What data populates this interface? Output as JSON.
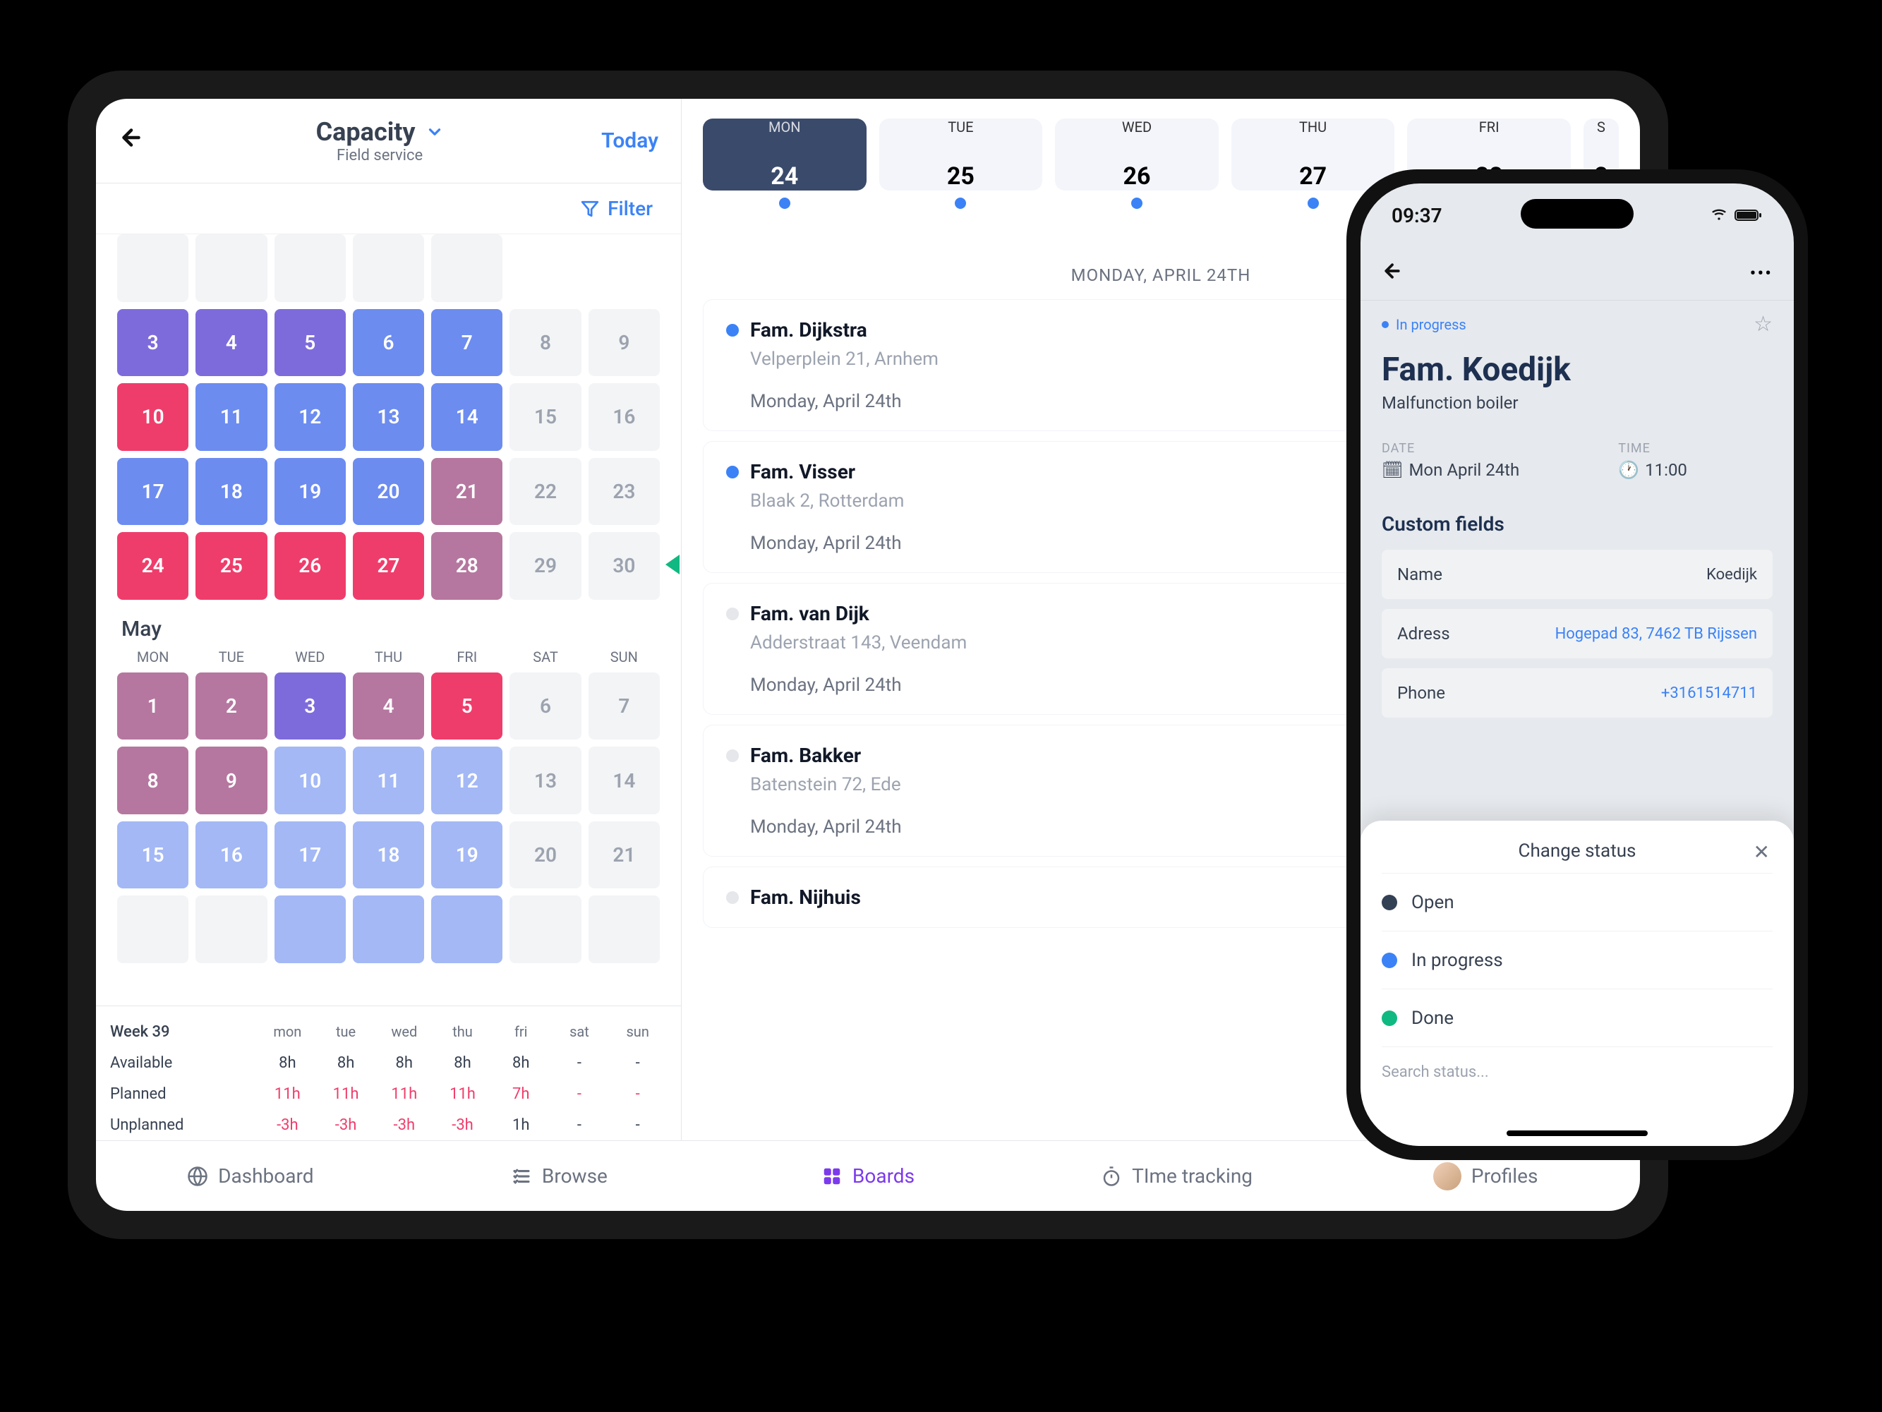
{
  "tablet": {
    "header": {
      "title": "Capacity",
      "subtitle": "Field service",
      "today": "Today",
      "filter": "Filter"
    },
    "calendar_top": {
      "rows": [
        [
          {
            "n": "3",
            "c": "purple"
          },
          {
            "n": "4",
            "c": "purple"
          },
          {
            "n": "5",
            "c": "purple"
          },
          {
            "n": "6",
            "c": "blue"
          },
          {
            "n": "7",
            "c": "blue"
          },
          {
            "n": "8",
            "c": "dim"
          },
          {
            "n": "9",
            "c": "dim"
          }
        ],
        [
          {
            "n": "10",
            "c": "pink"
          },
          {
            "n": "11",
            "c": "blue"
          },
          {
            "n": "12",
            "c": "blue"
          },
          {
            "n": "13",
            "c": "blue"
          },
          {
            "n": "14",
            "c": "blue"
          },
          {
            "n": "15",
            "c": "dim"
          },
          {
            "n": "16",
            "c": "dim"
          }
        ],
        [
          {
            "n": "17",
            "c": "blue"
          },
          {
            "n": "18",
            "c": "blue"
          },
          {
            "n": "19",
            "c": "blue"
          },
          {
            "n": "20",
            "c": "blue"
          },
          {
            "n": "21",
            "c": "mauve"
          },
          {
            "n": "22",
            "c": "dim"
          },
          {
            "n": "23",
            "c": "dim"
          }
        ],
        [
          {
            "n": "24",
            "c": "pink"
          },
          {
            "n": "25",
            "c": "pink"
          },
          {
            "n": "26",
            "c": "pink"
          },
          {
            "n": "27",
            "c": "pink"
          },
          {
            "n": "28",
            "c": "mauve"
          },
          {
            "n": "29",
            "c": "dim"
          },
          {
            "n": "30",
            "c": "dim"
          }
        ]
      ]
    },
    "month2_label": "May",
    "dow_full": [
      "MON",
      "TUE",
      "WED",
      "THU",
      "FRI",
      "SAT",
      "SUN"
    ],
    "calendar_may": {
      "rows": [
        [
          {
            "n": "1",
            "c": "mauve"
          },
          {
            "n": "2",
            "c": "mauve"
          },
          {
            "n": "3",
            "c": "purple"
          },
          {
            "n": "4",
            "c": "mauve"
          },
          {
            "n": "5",
            "c": "pink"
          },
          {
            "n": "6",
            "c": "dim"
          },
          {
            "n": "7",
            "c": "dim"
          }
        ],
        [
          {
            "n": "8",
            "c": "mauve"
          },
          {
            "n": "9",
            "c": "mauve"
          },
          {
            "n": "10",
            "c": "lightb"
          },
          {
            "n": "11",
            "c": "lightb"
          },
          {
            "n": "12",
            "c": "lightb"
          },
          {
            "n": "13",
            "c": "dim"
          },
          {
            "n": "14",
            "c": "dim"
          }
        ],
        [
          {
            "n": "15",
            "c": "lightb"
          },
          {
            "n": "16",
            "c": "lightb"
          },
          {
            "n": "17",
            "c": "lightb"
          },
          {
            "n": "18",
            "c": "lightb"
          },
          {
            "n": "19",
            "c": "lightb"
          },
          {
            "n": "20",
            "c": "dim"
          },
          {
            "n": "21",
            "c": "dim"
          }
        ],
        [
          {
            "n": "",
            "c": "blank"
          },
          {
            "n": "",
            "c": "blank"
          },
          {
            "n": "",
            "c": "lightb"
          },
          {
            "n": "",
            "c": "lightb"
          },
          {
            "n": "",
            "c": "lightb"
          },
          {
            "n": "",
            "c": "blank"
          },
          {
            "n": "",
            "c": "blank"
          }
        ]
      ]
    },
    "week_table": {
      "week_label": "Week 39",
      "head": [
        "mon",
        "tue",
        "wed",
        "thu",
        "fri",
        "sat",
        "sun"
      ],
      "rows": [
        {
          "label": "Available",
          "vals": [
            "8h",
            "8h",
            "8h",
            "8h",
            "8h",
            "-",
            "-"
          ],
          "neg": false
        },
        {
          "label": "Planned",
          "vals": [
            "11h",
            "11h",
            "11h",
            "11h",
            "7h",
            "-",
            "-"
          ],
          "neg": true
        },
        {
          "label": "Unplanned",
          "vals": [
            "-3h",
            "-3h",
            "-3h",
            "-3h",
            "1h",
            "-",
            "-"
          ],
          "neg": true
        }
      ]
    },
    "days": [
      {
        "dow": "MON",
        "num": "24",
        "active": true
      },
      {
        "dow": "TUE",
        "num": "25",
        "active": false
      },
      {
        "dow": "WED",
        "num": "26",
        "active": false
      },
      {
        "dow": "THU",
        "num": "27",
        "active": false
      },
      {
        "dow": "FRI",
        "num": "28",
        "active": false
      },
      {
        "dow": "S",
        "num": "2",
        "active": false
      }
    ],
    "day_heading": "MONDAY, APRIL 24TH",
    "cards": [
      {
        "title": "Fam. Dijkstra",
        "addr": "Velperplein 21, Arnhem",
        "date": "Monday, April 24th",
        "status": "blue"
      },
      {
        "title": "Fam. Visser",
        "addr": "Blaak 2, Rotterdam",
        "date": "Monday, April 24th",
        "status": "blue"
      },
      {
        "title": "Fam. van Dijk",
        "addr": "Adderstraat 143, Veendam",
        "date": "Monday, April 24th",
        "status": "grey"
      },
      {
        "title": "Fam. Bakker",
        "addr": "Batenstein 72, Ede",
        "date": "Monday, April 24th",
        "status": "grey"
      },
      {
        "title": "Fam. Nijhuis",
        "addr": "",
        "date": "",
        "status": "grey"
      }
    ],
    "tabs": [
      "Dashboard",
      "Browse",
      "Boards",
      "TIme tracking",
      "Profiles"
    ]
  },
  "phone": {
    "time": "09:37",
    "status_pill": "In progress",
    "title": "Fam. Koedijk",
    "subtitle": "Malfunction boiler",
    "date_label": "DATE",
    "date_value": "Mon April 24th",
    "time_label": "TIME",
    "time_value": "11:00",
    "custom_fields_label": "Custom fields",
    "fields": [
      {
        "k": "Name",
        "v": "Koedijk",
        "link": false
      },
      {
        "k": "Adress",
        "v": "Hogepad 83, 7462 TB Rijssen",
        "link": true
      },
      {
        "k": "Phone",
        "v": "+3161514711",
        "link": true
      }
    ],
    "sheet": {
      "title": "Change status",
      "options": [
        {
          "label": "Open",
          "color": "dark"
        },
        {
          "label": "In progress",
          "color": "blue"
        },
        {
          "label": "Done",
          "color": "green"
        }
      ],
      "search_placeholder": "Search status..."
    }
  }
}
